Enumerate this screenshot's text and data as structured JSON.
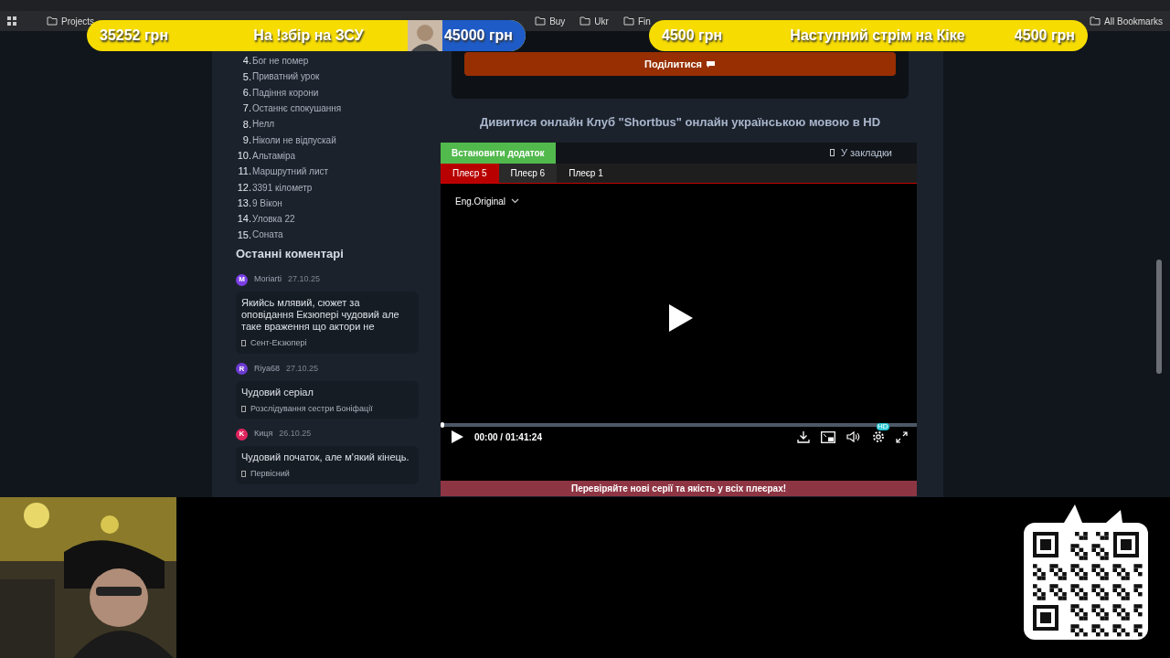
{
  "bookmarks": [
    {
      "label": "Projects"
    },
    {
      "label": "Buy"
    },
    {
      "label": "Ukr"
    },
    {
      "label": "Fin"
    }
  ],
  "all_bookmarks": "All Bookmarks",
  "banners": [
    {
      "left": "35252 грн",
      "title": "На !збір на ЗСУ",
      "right": "45000 грн",
      "kind": "split"
    },
    {
      "left": "4500 грн",
      "title": "Наступний стрім на Кіке",
      "right": "4500 грн",
      "kind": "plain"
    }
  ],
  "sidebar": {
    "list": [
      {
        "number": "4.",
        "title": "Бог не помер"
      },
      {
        "number": "5.",
        "title": "Приватний урок"
      },
      {
        "number": "6.",
        "title": "Падіння корони"
      },
      {
        "number": "7.",
        "title": "Останнє спокушання"
      },
      {
        "number": "8.",
        "title": "Нелл"
      },
      {
        "number": "9.",
        "title": "Ніколи не відпускай"
      },
      {
        "number": "10.",
        "title": "Альтаміра"
      },
      {
        "number": "11.",
        "title": "Маршрутний лист"
      },
      {
        "number": "12.",
        "title": "3391 кілометр"
      },
      {
        "number": "13.",
        "title": "9 Вікон"
      },
      {
        "number": "14.",
        "title": "Уловка 22"
      },
      {
        "number": "15.",
        "title": "Соната"
      }
    ],
    "comments_heading": "Останні коментарі",
    "comments": [
      {
        "initial": "M",
        "color": "#7b3fe4",
        "author": "Moriarti",
        "date": "27.10.25",
        "text": "Якийсь млявий, сюжет за оповідання Екзюпері чудовий але таке враження що актори не",
        "film": "Сент-Екзюпері"
      },
      {
        "initial": "R",
        "color": "#6d3bd1",
        "author": "Riya68",
        "date": "27.10.25",
        "text": "Чудовий серіал",
        "film": "Розслідування сестри Боніфації"
      },
      {
        "initial": "K",
        "color": "#e0245e",
        "author": "Киця",
        "date": "26.10.25",
        "text": "Чудовий початок, але м'який кінець.",
        "film": "Первісний"
      }
    ]
  },
  "share_button": "Поділитися",
  "watch_title": "Дивитися онлайн Клуб \"Shortbus\" онлайн українською мовою в HD",
  "player": {
    "install_button": "Встановити додаток",
    "bookmark": "У закладки",
    "tabs": [
      {
        "label": "Плеєр 5",
        "selected": true
      },
      {
        "label": "Плеєр 6",
        "selected": false
      },
      {
        "label": "Плеєр 1",
        "selected": false
      }
    ],
    "audio": "Eng.Original",
    "progress": {
      "level": 0
    },
    "time": "00:00 / 01:41:24",
    "quality_badge": "HD",
    "notice": "Перевіряйте нові серії та якість у всіх плеєрах!"
  }
}
